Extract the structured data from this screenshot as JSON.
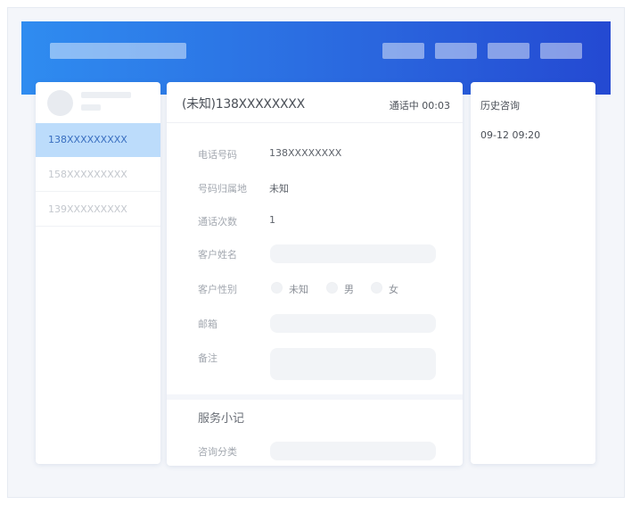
{
  "call_list": {
    "items": [
      {
        "number": "138XXXXXXXXX",
        "active": true
      },
      {
        "number": "158XXXXXXXXX",
        "active": false
      },
      {
        "number": "139XXXXXXXXX",
        "active": false
      }
    ]
  },
  "call": {
    "title": "(未知)138XXXXXXXX",
    "status": "通话中 00:03"
  },
  "customer_form": {
    "phone_label": "电话号码",
    "phone_value": "138XXXXXXXX",
    "location_label": "号码归属地",
    "location_value": "未知",
    "call_count_label": "通话次数",
    "call_count_value": "1",
    "name_label": "客户姓名",
    "name_value": "",
    "gender_label": "客户性别",
    "gender_options": [
      "未知",
      "男",
      "女"
    ],
    "email_label": "邮箱",
    "email_value": "",
    "notes_label": "备注",
    "notes_value": ""
  },
  "service_notes": {
    "title": "服务小记",
    "category_label": "咨询分类",
    "category_value": ""
  },
  "history": {
    "title": "历史咨询",
    "items": [
      {
        "time": "09-12 09:20"
      }
    ]
  },
  "colors": {
    "header_start": "#2f8cf0",
    "header_end": "#2449d2",
    "active_item_bg": "#bcdcfb",
    "active_item_text": "#3a6fc0"
  }
}
